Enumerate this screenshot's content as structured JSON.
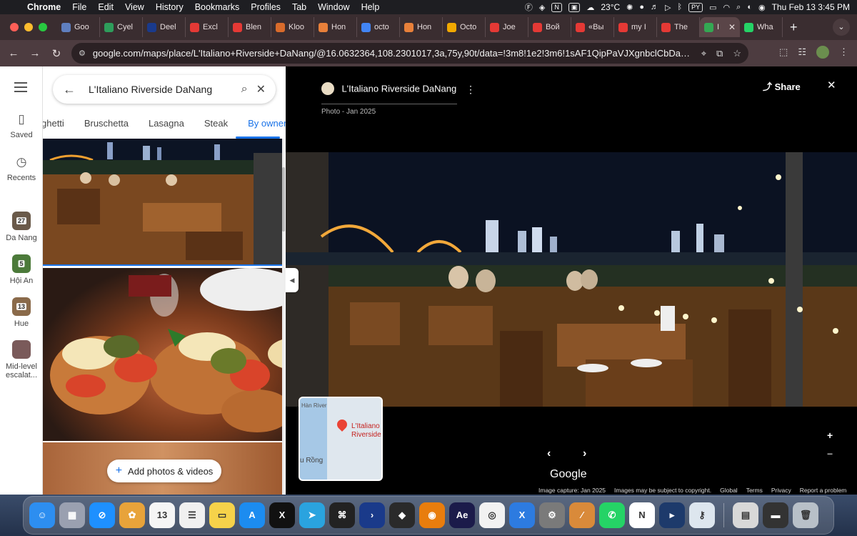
{
  "menubar": {
    "app": "Chrome",
    "items": [
      "File",
      "Edit",
      "View",
      "History",
      "Bookmarks",
      "Profiles",
      "Tab",
      "Window",
      "Help"
    ],
    "weather": "23°C",
    "lang": "PY",
    "datetime": "Thu Feb 13  3:45 PM"
  },
  "tabs": [
    {
      "label": "Goo",
      "color": "#5f7fbf"
    },
    {
      "label": "Cyel",
      "color": "#2e9d5b"
    },
    {
      "label": "Deel",
      "color": "#1a3a8c"
    },
    {
      "label": "Excl",
      "color": "#e53935"
    },
    {
      "label": "Blen",
      "color": "#e53935"
    },
    {
      "label": "Kloo",
      "color": "#d96b2b"
    },
    {
      "label": "Hon",
      "color": "#e8803a"
    },
    {
      "label": "octo",
      "color": "#4285f4"
    },
    {
      "label": "Hon",
      "color": "#e8803a"
    },
    {
      "label": "Octo",
      "color": "#f2a900"
    },
    {
      "label": "Joe",
      "color": "#e53935"
    },
    {
      "label": "Вой",
      "color": "#e53935"
    },
    {
      "label": "«Вы",
      "color": "#e53935"
    },
    {
      "label": "my I",
      "color": "#e53935"
    },
    {
      "label": "The",
      "color": "#e53935"
    },
    {
      "label": "I",
      "color": "#34a853",
      "active": true
    },
    {
      "label": "Wha",
      "color": "#25d366"
    }
  ],
  "omnibox": {
    "url": "google.com/maps/place/L'Italiano+Riverside+DaNang/@16.0632364,108.2301017,3a,75y,90t/data=!3m8!1e2!3m6!1sAF1QipPaVJXgnbclCbDaDC6J8..."
  },
  "rail": {
    "saved": "Saved",
    "recents": "Recents",
    "places": [
      {
        "label": "Da Nang",
        "count": "27",
        "color": "#6a5a4a"
      },
      {
        "label": "Hội An",
        "count": "5",
        "color": "#4c7a3a"
      },
      {
        "label": "Hue",
        "count": "13",
        "color": "#8a6a4a"
      },
      {
        "label": "Mid-level escalat...",
        "count": "",
        "color": "#7a5a5a"
      }
    ]
  },
  "panel": {
    "search_query": "L'Italiano Riverside DaNang",
    "chips": [
      "ghetti",
      "Bruschetta",
      "Lasagna",
      "Steak",
      "By owner"
    ],
    "active_chip": "By owner",
    "add_photos": "Add photos & videos"
  },
  "viewer": {
    "title": "L'Italiano Riverside DaNang",
    "subtitle": "Photo - Jan 2025",
    "share": "Share",
    "brand": "Google",
    "map_label": "L'Italiano Riverside",
    "map_road": "u Rồng",
    "map_river": "Hàn River",
    "footer": {
      "capture": "Image capture: Jan 2025",
      "copyright": "Images may be subject to copyright.",
      "global": "Global",
      "terms": "Terms",
      "privacy": "Privacy",
      "report": "Report a problem"
    }
  },
  "dock": {
    "apps": [
      {
        "name": "finder",
        "glyph": "☺",
        "color": "#2d8ef0"
      },
      {
        "name": "launchpad",
        "glyph": "▦",
        "color": "#9aa0b0"
      },
      {
        "name": "safari",
        "glyph": "⊘",
        "color": "#1e90ff"
      },
      {
        "name": "photos",
        "glyph": "✿",
        "color": "#e8a33a"
      },
      {
        "name": "calendar",
        "glyph": "13",
        "color": "#f5f5f5"
      },
      {
        "name": "reminders",
        "glyph": "☰",
        "color": "#f0f0f0"
      },
      {
        "name": "notes",
        "glyph": "▭",
        "color": "#f6d24a"
      },
      {
        "name": "app-store",
        "glyph": "A",
        "color": "#1c8cf0"
      },
      {
        "name": "x",
        "glyph": "X",
        "color": "#111111"
      },
      {
        "name": "telegram",
        "glyph": "➤",
        "color": "#2aa3df"
      },
      {
        "name": "chatgpt",
        "glyph": "⌘",
        "color": "#222222"
      },
      {
        "name": "cursor",
        "glyph": "›",
        "color": "#1a3a8a"
      },
      {
        "name": "figma",
        "glyph": "◆",
        "color": "#2a2a2a"
      },
      {
        "name": "blender",
        "glyph": "◉",
        "color": "#e87d0d"
      },
      {
        "name": "after-effects",
        "glyph": "Ae",
        "color": "#1b1b4a"
      },
      {
        "name": "chrome",
        "glyph": "◎",
        "color": "#f2f2f2"
      },
      {
        "name": "xcode",
        "glyph": "X",
        "color": "#2d7be0"
      },
      {
        "name": "settings",
        "glyph": "⚙",
        "color": "#7a7a7a"
      },
      {
        "name": "pages",
        "glyph": "∕",
        "color": "#d98a3a"
      },
      {
        "name": "whatsapp",
        "glyph": "✆",
        "color": "#25d366"
      },
      {
        "name": "notion",
        "glyph": "N",
        "color": "#ffffff"
      },
      {
        "name": "terminal-app",
        "glyph": "▸",
        "color": "#1d3a6b"
      },
      {
        "name": "keys",
        "glyph": "⚷",
        "color": "#dde6ee"
      }
    ],
    "extras": [
      {
        "name": "downloads",
        "glyph": "▤",
        "color": "#d8d8d8"
      },
      {
        "name": "recent-window",
        "glyph": "▬",
        "color": "#333333"
      },
      {
        "name": "trash",
        "glyph": "🗑",
        "color": "#b8c0c8"
      }
    ]
  }
}
